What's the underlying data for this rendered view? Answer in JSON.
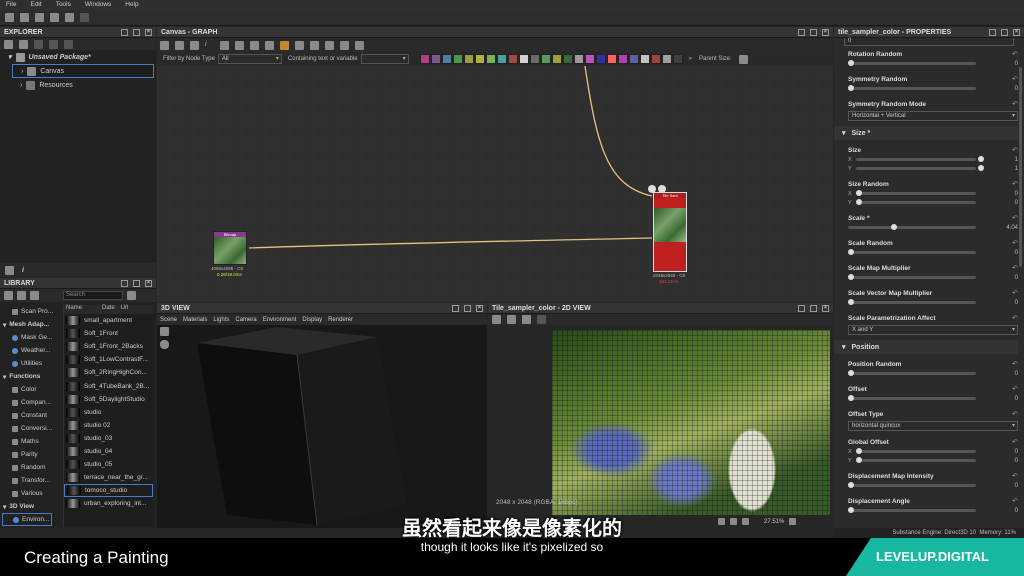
{
  "menubar": {
    "items": [
      "File",
      "Edit",
      "Tools",
      "Windows",
      "Help"
    ]
  },
  "explorer": {
    "title": "EXPLORER",
    "package": "Unsaved Package*",
    "items": [
      "Canvas",
      "Resources"
    ]
  },
  "graph": {
    "title": "Canvas - GRAPH",
    "filter_label": "Filter by Node Type",
    "filter_value": "All",
    "contains_label": "Containing text or variable",
    "parent_size": "Parent Size:",
    "node_left": {
      "label": "Bitmap",
      "res": "4096x4096 - C8",
      "time": "0.28/19.0ms"
    },
    "node_right": {
      "label": "Tile Sam",
      "res": "2048x2048 - C8",
      "time": "183.11ms"
    }
  },
  "library": {
    "title": "LIBRARY",
    "search_placeholder": "Search",
    "categories": [
      "Scan Pro...",
      "Mesh Adap...",
      "Mask Ge...",
      "Weather...",
      "Utilities",
      "Functions",
      "Color",
      "Compan...",
      "Constant",
      "Conversi...",
      "Maths",
      "Parity",
      "Random",
      "Transfor...",
      "Various",
      "3D View",
      "Environ..."
    ],
    "cols": [
      "Name",
      "Date",
      "Url"
    ],
    "items": [
      "small_apartment",
      "Soft_1Front",
      "Soft_1Front_2Backs",
      "Soft_1LowContrastF...",
      "Soft_2RingHighCon...",
      "Soft_4TubeBank_2B...",
      "Soft_5DaylightStudio",
      "studio",
      "studio 02",
      "studio_03",
      "studio_04",
      "studio_05",
      "terrace_near_the_gr...",
      "tomoco_studio",
      "urban_exploring_int..."
    ]
  },
  "view3d": {
    "title": "3D VIEW",
    "menu": [
      "Scene",
      "Materials",
      "Lights",
      "Camera",
      "Environment",
      "Display",
      "Renderer"
    ]
  },
  "view2d": {
    "title": "Tile_sampler_color - 2D VIEW",
    "info": "2048 x 2048 (RGBA, 16bpc)",
    "zoom": "27.51%"
  },
  "properties": {
    "title": "tile_sampler_color - PROPERTIES",
    "rows": [
      {
        "label": "Rotation Random",
        "type": "slider",
        "values": [
          "0"
        ],
        "pos": [
          0.0
        ]
      },
      {
        "label": "Symmetry Random",
        "type": "slider",
        "values": [
          "0"
        ],
        "pos": [
          0.0
        ]
      },
      {
        "label": "Symmetry Random Mode",
        "type": "dropdown",
        "value": "Horizontal + Vertical"
      },
      {
        "label": "Size *",
        "type": "section"
      },
      {
        "label": "Size",
        "type": "xy",
        "values": [
          "1",
          "1"
        ],
        "pos": [
          1.0,
          1.0
        ]
      },
      {
        "label": "Size Random",
        "type": "xy",
        "values": [
          "0",
          "0"
        ],
        "pos": [
          0.0,
          0.0
        ]
      },
      {
        "label": "Scale *",
        "type": "slider",
        "values": [
          "4.04"
        ],
        "pos": [
          0.35
        ]
      },
      {
        "label": "Scale Random",
        "type": "slider",
        "values": [
          "0"
        ],
        "pos": [
          0.0
        ]
      },
      {
        "label": "Scale Map Multiplier",
        "type": "slider",
        "values": [
          "0"
        ],
        "pos": [
          0.0
        ]
      },
      {
        "label": "Scale Vector Map Multiplier",
        "type": "slider",
        "values": [
          "0"
        ],
        "pos": [
          0.0
        ]
      },
      {
        "label": "Scale Parametrization Affect",
        "type": "dropdown",
        "value": "X and Y"
      },
      {
        "label": "Position",
        "type": "section"
      },
      {
        "label": "Position Random",
        "type": "slider",
        "values": [
          "0"
        ],
        "pos": [
          0.0
        ]
      },
      {
        "label": "Offset",
        "type": "slider",
        "values": [
          "0"
        ],
        "pos": [
          0.0
        ]
      },
      {
        "label": "Offset Type",
        "type": "dropdown",
        "value": "horizontal quincux"
      },
      {
        "label": "Global Offset",
        "type": "xy",
        "values": [
          "0",
          "0"
        ],
        "pos": [
          0.0,
          0.0
        ]
      },
      {
        "label": "Displacement Map Intensity",
        "type": "slider",
        "values": [
          "0"
        ],
        "pos": [
          0.0
        ]
      },
      {
        "label": "Displacement Angle",
        "type": "slider",
        "values": [
          "0"
        ],
        "pos": [
          0.0
        ]
      }
    ]
  },
  "status": {
    "engine": "Substance Engine: Direct3D 10",
    "memory": "Memory: 11%"
  },
  "subtitle": {
    "chinese": "虽然看起来像是像素化的",
    "english": "though it looks like it's pixelized so"
  },
  "banner": {
    "title": "Creating a Painting",
    "brand": "LEVELUP.DIGITAL"
  },
  "swatch_colors": [
    "#b04080",
    "#7a5a8a",
    "#4a7fa0",
    "#4a9a4a",
    "#9aa040",
    "#b0b040",
    "#7ab05a",
    "#4aa0a0",
    "#a04a4a",
    "#d0d0d0",
    "#6a6a6a",
    "#5a9a5a",
    "#a0a040",
    "#3a6a3a",
    "#9a9a9a",
    "#c050c0",
    "#3030a0",
    "#ff6060",
    "#b040b0",
    "#6060a0",
    "#c0c0c0",
    "#a04040",
    "#a0a0a0",
    "#404040"
  ]
}
